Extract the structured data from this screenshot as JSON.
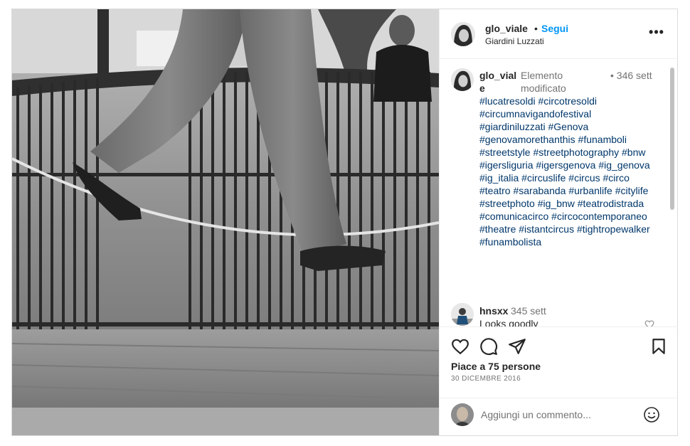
{
  "post": {
    "username": "glo_viale",
    "dot": "•",
    "follow_label": "Segui",
    "location": "Giardini Luzzati",
    "more_label": "•••"
  },
  "caption": {
    "username_line1": "glo_vial",
    "username_line2": "e",
    "edited": "Elemento modificato",
    "time_dot": "•",
    "time": "346 sett",
    "hashtags": "#lucatresoldi #circotresoldi #circumnavigandofestival #giardiniluzzati #Genova #genovamorethanthis #funamboli #streetstyle #streetphotography #bnw #igersliguria #igersgenova #ig_genova #ig_italia #circuslife #circus #circo #teatro #sarabanda #urbanlife #citylife #streetphoto #ig_bnw #teatrodistrada #comunicacirco #circocontemporaneo #theatre #istantcircus #tightropewalker #funambolista"
  },
  "comment": {
    "username": "hnsxx",
    "time": "345 sett",
    "text": "Looks goodly"
  },
  "actions": {
    "likes": "Piace a 75 persone",
    "date": "30 DICEMBRE 2016"
  },
  "add_comment": {
    "placeholder": "Aggiungi un commento..."
  },
  "colors": {
    "accent": "#0095f6",
    "hashtag": "#00376b",
    "text": "#262626",
    "secondary": "#737373",
    "border": "#dbdbdb"
  },
  "icons": [
    "more-icon",
    "heart-icon",
    "comment-icon",
    "share-icon",
    "bookmark-icon",
    "emoji-icon"
  ]
}
